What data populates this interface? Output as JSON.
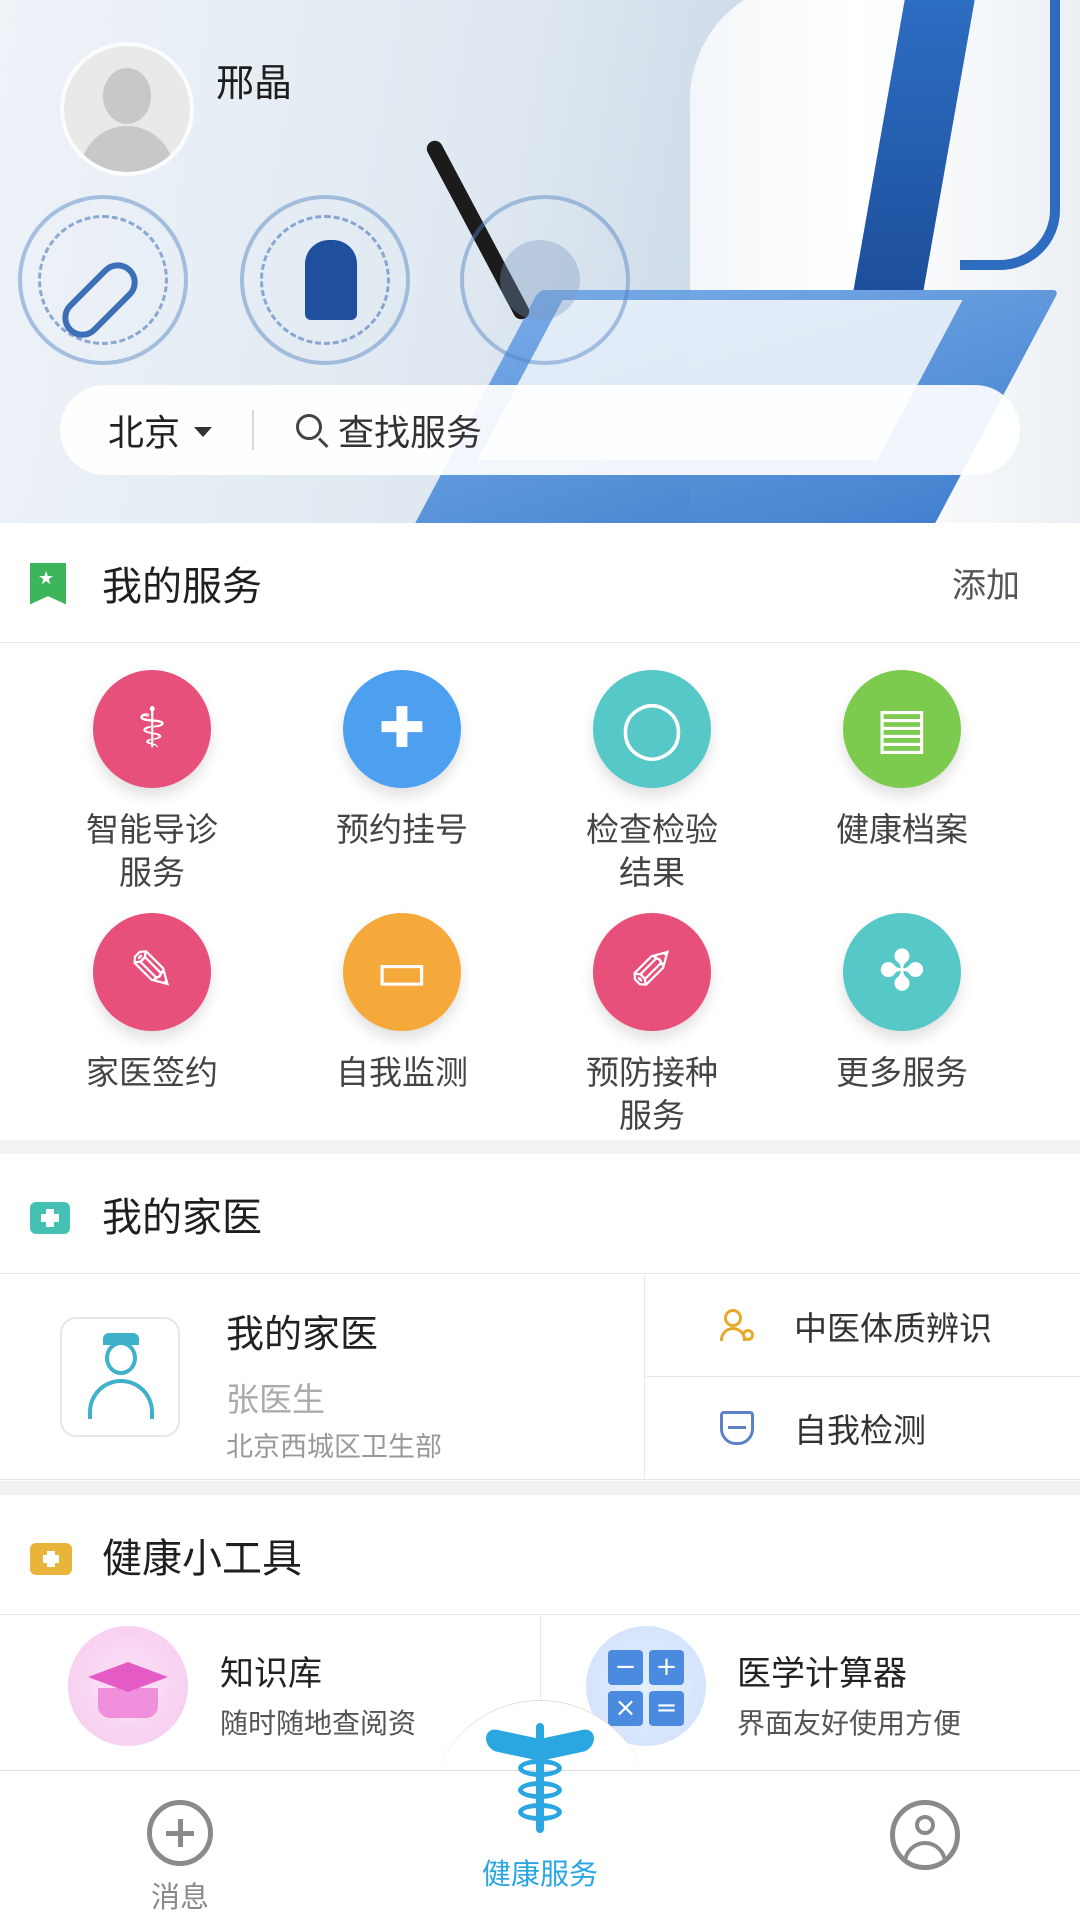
{
  "user": {
    "name": "邢晶"
  },
  "search": {
    "city": "北京",
    "placeholder": "查找服务"
  },
  "my_services": {
    "title": "我的服务",
    "action": "添加",
    "items": [
      {
        "label": "智能导诊服务",
        "icon": "stethoscope-icon",
        "color": "#e8507c"
      },
      {
        "label": "预约挂号",
        "icon": "tag-icon",
        "color": "#4d9ff0"
      },
      {
        "label": "检查检验结果",
        "icon": "lightbulb-icon",
        "color": "#56c8c8"
      },
      {
        "label": "健康档案",
        "icon": "document-icon",
        "color": "#7ccb4e"
      },
      {
        "label": "家医签约",
        "icon": "sign-icon",
        "color": "#e8507c"
      },
      {
        "label": "自我监测",
        "icon": "monitor-icon",
        "color": "#f4a93a"
      },
      {
        "label": "预防接种服务",
        "icon": "syringe-icon",
        "color": "#e8507c"
      },
      {
        "label": "更多服务",
        "icon": "clover-icon",
        "color": "#56c8c8"
      }
    ]
  },
  "family_doctor": {
    "title": "我的家医",
    "card_title": "我的家医",
    "doctor_name": "张医生",
    "organization": "北京西城区卫生部",
    "links": [
      {
        "label": "中医体质辨识",
        "icon": "person-search-icon"
      },
      {
        "label": "自我检测",
        "icon": "shield-icon"
      }
    ]
  },
  "tools": {
    "title": "健康小工具",
    "items": [
      {
        "title": "知识库",
        "desc": "随时随地查阅资",
        "icon": "graduation-cap-icon"
      },
      {
        "title": "医学计算器",
        "desc": "界面友好使用方便",
        "icon": "calculator-icon"
      }
    ]
  },
  "bottom_nav": {
    "items": [
      {
        "label": "消息",
        "icon": "message-plus-icon",
        "active": false
      },
      {
        "label": "健康服务",
        "icon": "caduceus-icon",
        "active": true
      },
      {
        "label": "",
        "icon": "user-icon",
        "active": false
      }
    ],
    "active_color": "#2aa6e0",
    "inactive_color": "#8a8a8a"
  }
}
